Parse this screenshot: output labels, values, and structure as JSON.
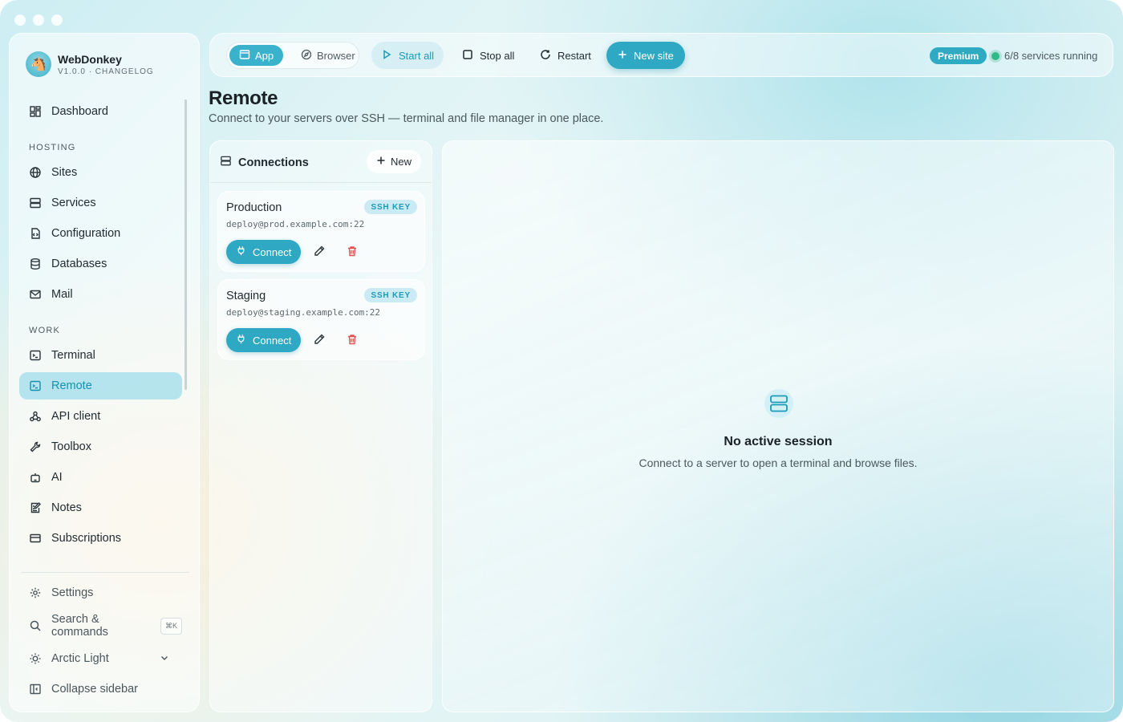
{
  "app": {
    "name": "WebDonkey",
    "version_line": "V1.0.0 · CHANGELOG"
  },
  "sidebar": {
    "dashboard": "Dashboard",
    "sections": {
      "hosting": "HOSTING",
      "work": "WORK"
    },
    "hosting_items": [
      "Sites",
      "Services",
      "Configuration",
      "Databases",
      "Mail"
    ],
    "work_items": [
      "Terminal",
      "Remote",
      "API client",
      "Toolbox",
      "AI",
      "Notes",
      "Subscriptions"
    ],
    "active_item": "Remote",
    "settings": "Settings",
    "search": "Search & commands",
    "search_shortcut": "⌘K",
    "theme": "Arctic Light",
    "collapse": "Collapse sidebar"
  },
  "toolbar": {
    "mode_app": "App",
    "mode_browser": "Browser",
    "start_all": "Start all",
    "stop_all": "Stop all",
    "restart": "Restart",
    "new_site": "New site",
    "premium": "Premium",
    "services_status": "6/8 services running"
  },
  "page": {
    "title": "Remote",
    "subtitle": "Connect to your servers over SSH — terminal and file manager in one place."
  },
  "connections": {
    "title": "Connections",
    "new_label": "New",
    "items": [
      {
        "name": "Production",
        "auth": "SSH KEY",
        "host": "deploy@prod.example.com:22",
        "action": "Connect"
      },
      {
        "name": "Staging",
        "auth": "SSH KEY",
        "host": "deploy@staging.example.com:22",
        "action": "Connect"
      }
    ]
  },
  "session": {
    "empty_title": "No active session",
    "empty_subtitle": "Connect to a server to open a terminal and browse files."
  },
  "colors": {
    "accent": "#2fa9c3",
    "active_text": "#1691ad",
    "status_ok": "#32b98a",
    "danger": "#e05252"
  }
}
